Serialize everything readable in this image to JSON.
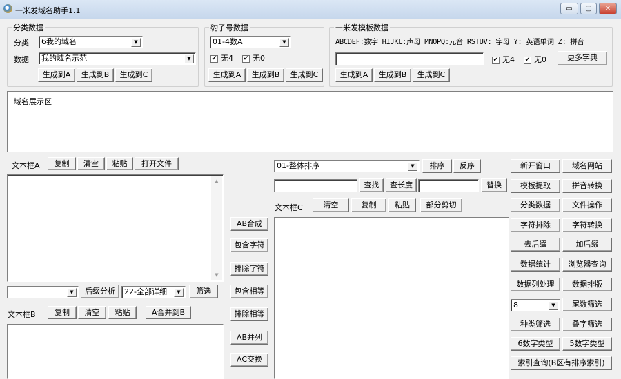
{
  "window": {
    "title": "一米发域名助手1.1",
    "min": "▭",
    "max": "▢",
    "close": "✕"
  },
  "category": {
    "title": "分类数据",
    "cat_label": "分类",
    "cat_value": "6我的域名",
    "data_label": "数据",
    "data_value": "我的域名示范",
    "gen_a": "生成到A",
    "gen_b": "生成到B",
    "gen_c": "生成到C"
  },
  "leopard": {
    "title": "豹子号数据",
    "select_value": "01-4数A",
    "no4": "无4",
    "no0": "无0",
    "gen_a": "生成到A",
    "gen_b": "生成到B",
    "gen_c": "生成到C"
  },
  "template": {
    "title": "一米发模板数据",
    "legend": "ABCDEF:数字 HIJKL:声母 MNOPQ:元音 RSTUV: 字母 Y: 英语单词 Z: 拼音",
    "input_value": "",
    "no4": "无4",
    "no0": "无0",
    "more": "更多字典",
    "gen_a": "生成到A",
    "gen_b": "生成到B",
    "gen_c": "生成到C"
  },
  "display": {
    "placeholder": "域名展示区"
  },
  "boxA": {
    "label": "文本框A",
    "copy": "复制",
    "clear": "清空",
    "paste": "粘贴",
    "open": "打开文件"
  },
  "filter": {
    "select1": "",
    "suffix": "后缀分析",
    "select2": "22-全部详细",
    "filter": "筛选"
  },
  "boxB": {
    "label": "文本框B",
    "copy": "复制",
    "clear": "清空",
    "paste": "粘贴",
    "merge": "A合并到B"
  },
  "middle": [
    "AB合成",
    "包含字符",
    "排除字符",
    "包含相等",
    "排除相等",
    "AB并列",
    "AC交换"
  ],
  "sort": {
    "select": "01-整体排序",
    "sort": "排序",
    "reverse": "反序",
    "find_value": "",
    "find": "查找",
    "length": "查长度",
    "replace_value": "",
    "replace": "替换"
  },
  "boxC": {
    "label": "文本框C",
    "clear": "清空",
    "copy": "复制",
    "paste": "粘贴",
    "cut": "部分剪切"
  },
  "right": {
    "rows": [
      [
        "新开窗口",
        "域名网站"
      ],
      [
        "模板提取",
        "拼音转换"
      ],
      [
        "分类数据",
        "文件操作"
      ],
      [
        "字符排除",
        "字符转换"
      ],
      [
        "去后缀",
        "加后缀"
      ],
      [
        "数据统计",
        "浏览器查询"
      ],
      [
        "数据列处理",
        "数据排版"
      ]
    ],
    "tail_select": "8",
    "tail_filter": "尾数筛选",
    "rows2": [
      [
        "种类筛选",
        "叠字筛选"
      ],
      [
        "6数字类型",
        "5数字类型"
      ]
    ],
    "index": "索引查询(B区有排序索引)"
  }
}
